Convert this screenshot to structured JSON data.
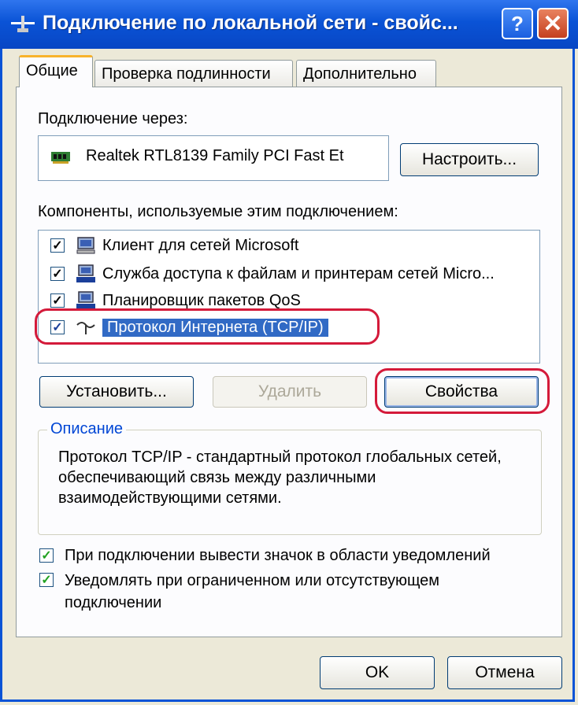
{
  "window": {
    "title": "Подключение по локальной сети - свойс...",
    "help_label": "?",
    "close_label": "✕"
  },
  "tabs": [
    {
      "label": "Общие",
      "active": true
    },
    {
      "label": "Проверка подлинности",
      "active": false
    },
    {
      "label": "Дополнительно",
      "active": false
    }
  ],
  "connect_via": {
    "label": "Подключение через:",
    "adapter": "Realtek RTL8139 Family PCI Fast Et",
    "configure_button": "Настроить..."
  },
  "components": {
    "label": "Компоненты, используемые этим подключением:",
    "items": [
      {
        "label": "Клиент для сетей Microsoft",
        "checked": true,
        "icon": "network-client-icon"
      },
      {
        "label": "Служба доступа к файлам и принтерам сетей Micro...",
        "checked": true,
        "icon": "network-service-icon"
      },
      {
        "label": "Планировщик пакетов QoS",
        "checked": true,
        "icon": "network-service-icon"
      },
      {
        "label": "Протокол Интернета (TCP/IP)",
        "checked": true,
        "selected": true,
        "icon": "network-protocol-icon"
      }
    ],
    "install_button": "Установить...",
    "remove_button": "Удалить",
    "properties_button": "Свойства"
  },
  "description": {
    "title": "Описание",
    "text": "Протокол TCP/IP - стандартный протокол глобальных сетей, обеспечивающий связь между различными взаимодействующими сетями."
  },
  "options": [
    {
      "label": "При подключении вывести значок в области уведомлений",
      "checked": true
    },
    {
      "label": "Уведомлять при ограниченном или отсутствующем подключении",
      "checked": true
    }
  ],
  "footer": {
    "ok_button": "OK",
    "cancel_button": "Отмена"
  },
  "colors": {
    "titlebar": "#0a53d6",
    "highlight": "#d41a3a",
    "selection": "#316ac5"
  }
}
